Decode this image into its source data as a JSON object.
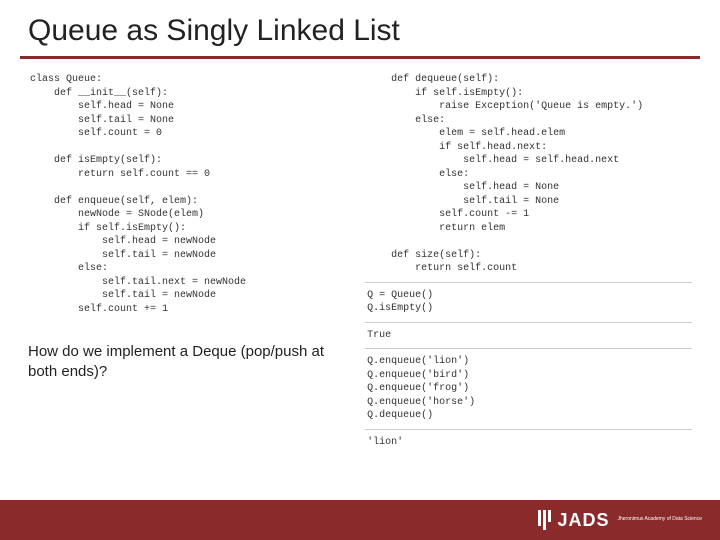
{
  "title": "Queue as Singly Linked List",
  "left_code": "class Queue:\n    def __init__(self):\n        self.head = None\n        self.tail = None\n        self.count = 0\n\n    def isEmpty(self):\n        return self.count == 0\n\n    def enqueue(self, elem):\n        newNode = SNode(elem)\n        if self.isEmpty():\n            self.head = newNode\n            self.tail = newNode\n        else:\n            self.tail.next = newNode\n            self.tail = newNode\n        self.count += 1",
  "right_code_1": "    def dequeue(self):\n        if self.isEmpty():\n            raise Exception('Queue is empty.')\n        else:\n            elem = self.head.elem\n            if self.head.next:\n                self.head = self.head.next\n            else:\n                self.head = None\n                self.tail = None\n            self.count -= 1\n            return elem\n\n    def size(self):\n        return self.count",
  "right_code_2": "Q = Queue()\nQ.isEmpty()",
  "right_out_2": "True",
  "right_code_3": "Q.enqueue('lion')\nQ.enqueue('bird')\nQ.enqueue('frog')\nQ.enqueue('horse')\nQ.dequeue()",
  "right_out_3": "'lion'",
  "question": "How do we implement a Deque (pop/push at both ends)?",
  "logo_text": "JADS",
  "logo_sub": "Jheronimus\nAcademy\nof Data Science"
}
